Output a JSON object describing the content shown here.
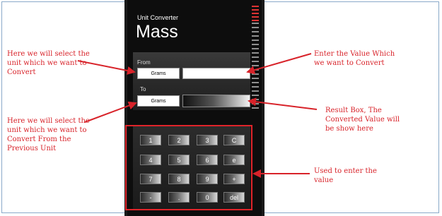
{
  "app": {
    "name": "Unit Converter",
    "page_title": "Mass"
  },
  "converter": {
    "from_label": "From",
    "from_unit": "Grams",
    "to_label": "To",
    "to_unit": "Grams",
    "input_value": "",
    "result_value": ""
  },
  "keypad": {
    "rows": [
      [
        "1",
        "2",
        "3",
        "C"
      ],
      [
        "4",
        "5",
        "6",
        "e"
      ],
      [
        "7",
        "8",
        "9",
        "+"
      ],
      [
        "-",
        ".",
        "0",
        "del"
      ]
    ]
  },
  "annotations": {
    "from_unit": "Here we will select the unit which we want to Convert",
    "enter_value": "Enter the Value Which we want to Convert",
    "to_unit": "Here we will select the unit which we want to Convert From the Previous Unit",
    "result": "Result Box, The Converted Value will be show here",
    "keypad": "Used to enter the value"
  },
  "colors": {
    "annotation": "#d8232a",
    "phone_bg": "#0d0d0d"
  }
}
